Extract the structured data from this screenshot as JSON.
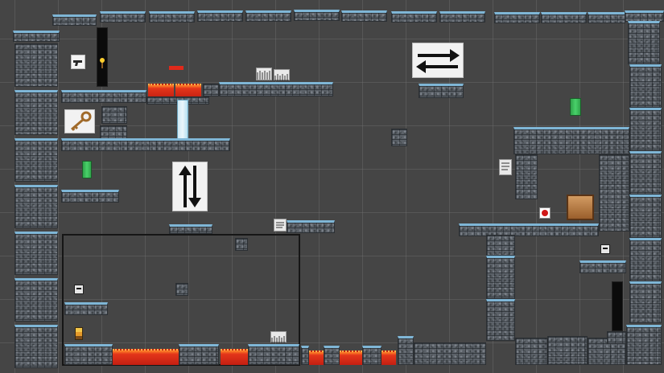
{
  "scene": {
    "background_color": "#454545",
    "level_elements": {
      "walls": "stone-blocks",
      "hazards": [
        "lava-pool-1",
        "lava-pool-2",
        "lava-pool-3",
        "lava-pool-4",
        "lava-pool-5",
        "lava-pool-6",
        "lava-pool-7"
      ],
      "doors": [
        "door-left",
        "door-right"
      ],
      "pickups": [
        "key",
        "green-door-1",
        "green-door-2"
      ],
      "signs": [
        "arrow-horizontal",
        "arrow-vertical"
      ]
    },
    "colors": {
      "stone": "#5b6168",
      "ice_top": "#7fb6d6",
      "lava": "#e3361a",
      "door": "#0b0b0b",
      "green_door": "#49d16a",
      "crate": "#d29b62",
      "button": "#d01818"
    },
    "icons": {
      "gun": "gun-icon",
      "torch": "torch-icon",
      "key": "key-icon",
      "arrows_h": "swap-horizontal-icon",
      "arrows_v": "swap-vertical-icon",
      "spikes": "spike-trap-icon",
      "scroll": "note-icon"
    }
  }
}
